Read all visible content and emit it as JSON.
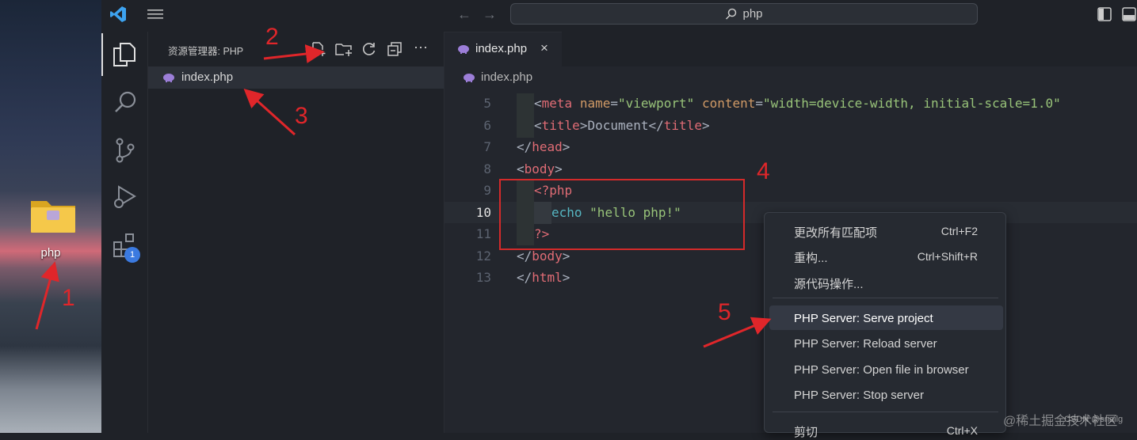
{
  "desktop": {
    "folder_label": "php"
  },
  "titlebar": {
    "search_text": "php"
  },
  "activitybar": {
    "extensions_badge": "1"
  },
  "sidebar": {
    "title": "资源管理器: PHP",
    "files": [
      "index.php"
    ]
  },
  "editor": {
    "tab_label": "index.php",
    "tab_close": "×",
    "breadcrumb": "index.php",
    "line_numbers": [
      "5",
      "6",
      "7",
      "8",
      "9",
      "10",
      "11",
      "12",
      "13"
    ],
    "active_line": "10"
  },
  "context_menu": {
    "items": [
      {
        "label": "更改所有匹配项",
        "shortcut": "Ctrl+F2"
      },
      {
        "label": "重构...",
        "shortcut": "Ctrl+Shift+R"
      },
      {
        "label": "源代码操作...",
        "shortcut": ""
      },
      {
        "label": "PHP Server: Serve project",
        "shortcut": ""
      },
      {
        "label": "PHP Server: Reload server",
        "shortcut": ""
      },
      {
        "label": "PHP Server: Open file in browser",
        "shortcut": ""
      },
      {
        "label": "PHP Server: Stop server",
        "shortcut": ""
      },
      {
        "label": "剪切",
        "shortcut": "Ctrl+X"
      }
    ]
  },
  "annotations": {
    "numbers": [
      "1",
      "2",
      "3",
      "4",
      "5"
    ],
    "color": "#e0262a"
  },
  "watermark": {
    "text": "@稀土掘金技术社区",
    "small": "CSDN @snailg"
  },
  "colors": {
    "tag": "#e06c75",
    "attribute": "#d19a66",
    "string": "#98c379",
    "keyword": "#56b6c2",
    "accent": "#3b7ae0"
  }
}
